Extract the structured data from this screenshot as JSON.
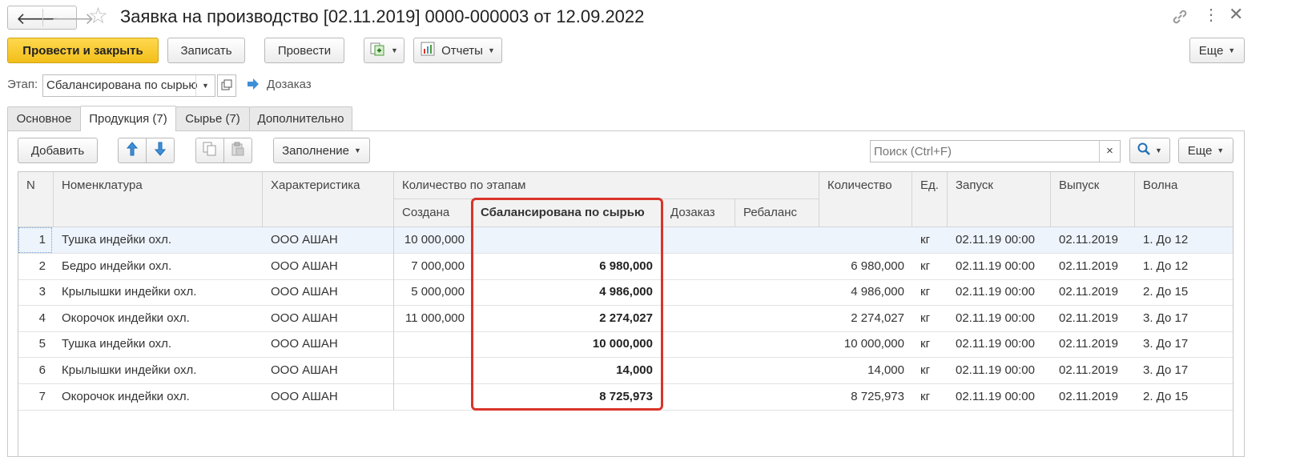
{
  "window": {
    "title": "Заявка на производство [02.11.2019] 0000-000003 от 12.09.2022"
  },
  "toolbar": {
    "post_close": "Провести и закрыть",
    "save": "Записать",
    "post": "Провести",
    "reports": "Отчеты",
    "more": "Еще"
  },
  "stage": {
    "label": "Этап:",
    "value": "Сбалансирована по сырью",
    "next_link": "Дозаказ"
  },
  "tabs": [
    "Основное",
    "Продукция (7)",
    "Сырье (7)",
    "Дополнительно"
  ],
  "table_toolbar": {
    "add": "Добавить",
    "fill": "Заполнение",
    "search_placeholder": "Поиск (Ctrl+F)",
    "clear": "×",
    "more": "Еще"
  },
  "columns": {
    "n": "N",
    "nomenclature": "Номенклатура",
    "characteristic": "Характеристика",
    "qty_by_stage": "Количество по этапам",
    "created": "Создана",
    "balanced": "Сбалансирована по сырью",
    "reorder": "Дозаказ",
    "rebalance": "Ребаланс",
    "quantity": "Количество",
    "unit": "Ед.",
    "launch": "Запуск",
    "release": "Выпуск",
    "wave": "Волна"
  },
  "rows": [
    {
      "n": "1",
      "nomenclature": "Тушка индейки охл.",
      "characteristic": "ООО АШАН",
      "created": "10 000,000",
      "balanced": "",
      "reorder": "",
      "rebalance": "",
      "quantity": "",
      "unit": "кг",
      "launch": "02.11.19 00:00",
      "release": "02.11.2019",
      "wave": "1. До 12"
    },
    {
      "n": "2",
      "nomenclature": "Бедро индейки охл.",
      "characteristic": "ООО АШАН",
      "created": "7 000,000",
      "balanced": "6 980,000",
      "reorder": "",
      "rebalance": "",
      "quantity": "6 980,000",
      "unit": "кг",
      "launch": "02.11.19 00:00",
      "release": "02.11.2019",
      "wave": "1. До 12"
    },
    {
      "n": "3",
      "nomenclature": "Крылышки индейки охл.",
      "characteristic": "ООО АШАН",
      "created": "5 000,000",
      "balanced": "4 986,000",
      "reorder": "",
      "rebalance": "",
      "quantity": "4 986,000",
      "unit": "кг",
      "launch": "02.11.19 00:00",
      "release": "02.11.2019",
      "wave": "2. До 15"
    },
    {
      "n": "4",
      "nomenclature": "Окорочок индейки охл.",
      "characteristic": "ООО АШАН",
      "created": "11 000,000",
      "balanced": "2 274,027",
      "reorder": "",
      "rebalance": "",
      "quantity": "2 274,027",
      "unit": "кг",
      "launch": "02.11.19 00:00",
      "release": "02.11.2019",
      "wave": "3. До 17"
    },
    {
      "n": "5",
      "nomenclature": "Тушка индейки охл.",
      "characteristic": "ООО АШАН",
      "created": "",
      "balanced": "10 000,000",
      "reorder": "",
      "rebalance": "",
      "quantity": "10 000,000",
      "unit": "кг",
      "launch": "02.11.19 00:00",
      "release": "02.11.2019",
      "wave": "3. До 17"
    },
    {
      "n": "6",
      "nomenclature": "Крылышки индейки охл.",
      "characteristic": "ООО АШАН",
      "created": "",
      "balanced": "14,000",
      "reorder": "",
      "rebalance": "",
      "quantity": "14,000",
      "unit": "кг",
      "launch": "02.11.19 00:00",
      "release": "02.11.2019",
      "wave": "3. До 17"
    },
    {
      "n": "7",
      "nomenclature": "Окорочок индейки охл.",
      "characteristic": "ООО АШАН",
      "created": "",
      "balanced": "8 725,973",
      "reorder": "",
      "rebalance": "",
      "quantity": "8 725,973",
      "unit": "кг",
      "launch": "02.11.19 00:00",
      "release": "02.11.2019",
      "wave": "2. До 15"
    }
  ],
  "colors": {
    "primary_button": "#f2bf1a",
    "highlight": "#d9342b",
    "link_arrow": "#3f8fd6"
  }
}
